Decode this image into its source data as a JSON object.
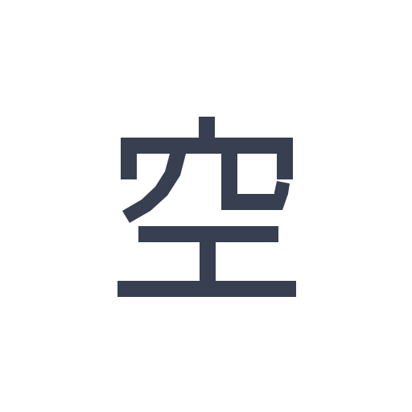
{
  "glyph": {
    "character": "空",
    "color": "#373f51",
    "background": "#ffffff"
  }
}
